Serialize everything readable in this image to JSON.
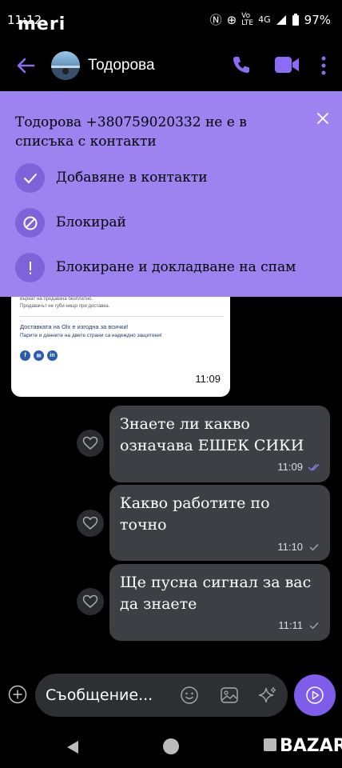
{
  "status": {
    "time": "11:12",
    "watermark": "meri",
    "battery": "97%",
    "volte_top": "Vo",
    "volte_bottom": "LTE",
    "network": "4G"
  },
  "header": {
    "contact_name": "Тодорова"
  },
  "banner": {
    "title": "Тодорова +380759020332 не е в списъка с контакти",
    "options": [
      {
        "label": "Добавяне в контакти",
        "icon": "check-icon"
      },
      {
        "label": "Блокирай",
        "icon": "block-icon"
      },
      {
        "label": "Блокиране и докладване на спам",
        "icon": "exclamation-icon"
      }
    ]
  },
  "image_message": {
    "line1": "върнат на продавача безплатно.",
    "line2": "Продавачът не губи нищо при доставка.",
    "line3": "Доставката на Olx е изгодна за всички!",
    "line4": "Парите и данните на двете страни са надеждно защитени!",
    "social": [
      "f",
      "✉",
      "in"
    ],
    "time": "11:09"
  },
  "messages": [
    {
      "text": "Знаете ли какво означава ЕШЕК СИКИ",
      "time": "11:09",
      "status": "read"
    },
    {
      "text": "Какво работите по точно",
      "time": "11:10",
      "status": "sent"
    },
    {
      "text": "Ще пусна сигнал за вас да знаете",
      "time": "11:11",
      "status": "sent"
    }
  ],
  "composer": {
    "placeholder": "Съобщение..."
  },
  "footer_logo": "BAZAR",
  "colors": {
    "accent": "#7f5dea",
    "banner": "#9c83f0",
    "bubble": "#3e3f44"
  }
}
